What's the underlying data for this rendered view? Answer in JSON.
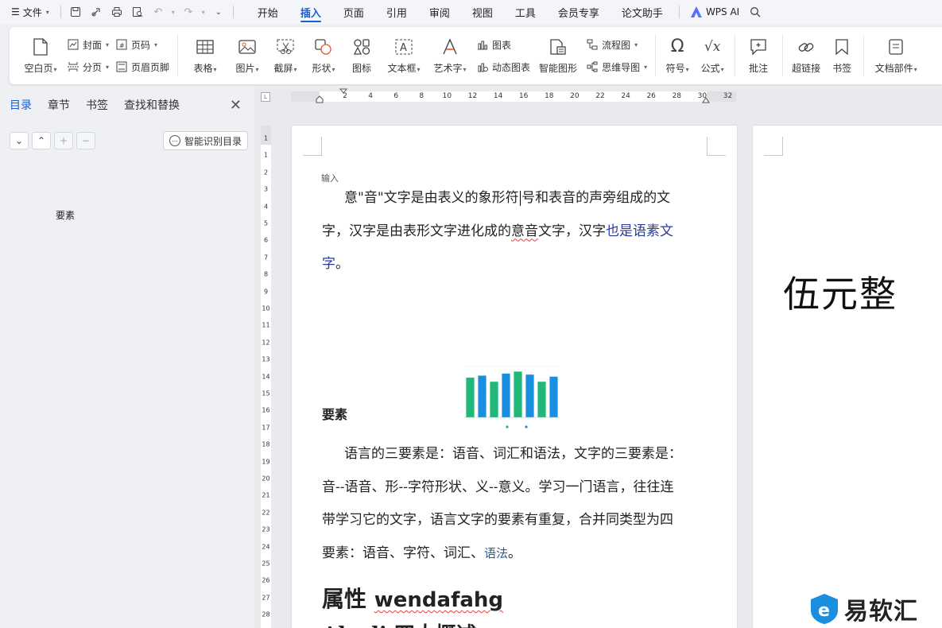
{
  "menubar": {
    "file_label": "文件",
    "tabs": [
      {
        "label": "开始",
        "active": false
      },
      {
        "label": "插入",
        "active": true
      },
      {
        "label": "页面",
        "active": false
      },
      {
        "label": "引用",
        "active": false
      },
      {
        "label": "审阅",
        "active": false
      },
      {
        "label": "视图",
        "active": false
      },
      {
        "label": "工具",
        "active": false
      },
      {
        "label": "会员专享",
        "active": false
      },
      {
        "label": "论文助手",
        "active": false
      }
    ],
    "wps_ai_label": "WPS AI"
  },
  "ribbon": {
    "blank_page": "空白页",
    "cover": "封面",
    "page_break": "分页",
    "page_number": "页码",
    "header_footer": "页眉页脚",
    "table": "表格",
    "picture": "图片",
    "screenshot": "截屏",
    "shape": "形状",
    "icon": "图标",
    "textbox": "文本框",
    "wordart": "艺术字",
    "chart": "图表",
    "dynamic_chart": "动态图表",
    "smart_graphic": "智能图形",
    "flowchart": "流程图",
    "mindmap": "思维导图",
    "symbol": "符号",
    "formula": "公式",
    "comment": "批注",
    "hyperlink": "超链接",
    "bookmark": "书签",
    "doc_parts": "文档部件"
  },
  "navpane": {
    "tabs": [
      {
        "label": "目录",
        "active": true
      },
      {
        "label": "章节",
        "active": false
      },
      {
        "label": "书签",
        "active": false
      },
      {
        "label": "查找和替换",
        "active": false
      }
    ],
    "smart_toc_label": "智能识别目录",
    "entry": "要素"
  },
  "ruler": {
    "h_numbers": [
      "2",
      "4",
      "6",
      "8",
      "10",
      "12",
      "14",
      "16",
      "18",
      "20",
      "22",
      "24",
      "26",
      "28",
      "30",
      "32"
    ],
    "v_numbers": [
      "1",
      "1",
      "2",
      "3",
      "4",
      "5",
      "6",
      "7",
      "8",
      "9",
      "10",
      "11",
      "12",
      "13",
      "14",
      "15",
      "16",
      "17",
      "18",
      "19",
      "20",
      "21",
      "22",
      "23",
      "24",
      "25",
      "26",
      "27",
      "28"
    ]
  },
  "document": {
    "input_label": "输入",
    "p1_a": "意\"音\"文字是由表义的象形符",
    "p1_b": "号和表音的声旁组成的文",
    "p1_line2_a": "字，汉字是由表形文字进化成的",
    "p1_line2_wavy": "意音",
    "p1_line2_b": "文字，汉字",
    "p1_line2_blue": "也是语素文",
    "p1_line3_blue": "字",
    "p1_line3_end": "。",
    "heading": "要素",
    "p2_line1": "语言的三要素是：语音、词汇和语法，文字的三要素是：",
    "p2_line2": "音--语音、形--字符形状、义--意义。学习一门语言，往往连",
    "p2_line3": "带学习它的文字，语言文字的要素有重复，合并同类型为四",
    "p2_line4_a": "要素：语音、字符、词汇、",
    "p2_line4_teal": "语法",
    "p2_line4_end": "。",
    "h1_cn": "属性 ",
    "h1_en": "wendafahg",
    "h1b": "Ahsdi 四大概述",
    "page2_text": "伍元整"
  },
  "chart_data": {
    "type": "bar",
    "categories": [
      "",
      "",
      "",
      "",
      "",
      "",
      "",
      ""
    ],
    "series": [
      {
        "values": [
          78,
          82,
          70,
          86,
          90,
          84,
          70,
          80
        ]
      }
    ],
    "ylim": [
      0,
      100
    ],
    "colors": [
      "#1fb87a",
      "#1a8fe0"
    ]
  },
  "watermark": {
    "text": "易软汇"
  },
  "colors": {
    "accent": "#1a5fd1"
  }
}
